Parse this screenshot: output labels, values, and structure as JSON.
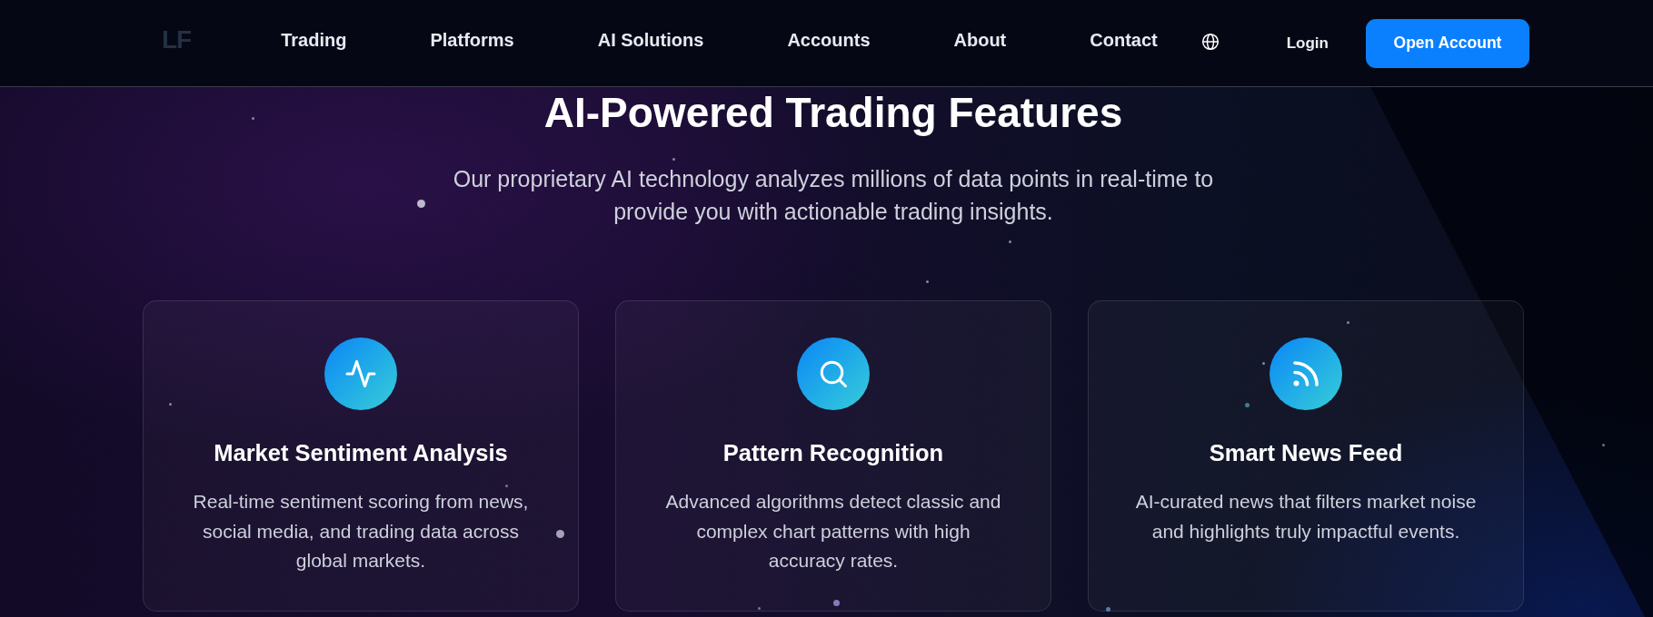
{
  "header": {
    "logo": "LF",
    "nav": [
      "Trading",
      "Platforms",
      "AI Solutions",
      "Accounts",
      "About",
      "Contact"
    ],
    "login": "Login",
    "cta": "Open Account"
  },
  "hero": {
    "title": "AI-Powered Trading Features",
    "subtitle": "Our proprietary AI technology analyzes millions of data points in real-time to provide you with actionable trading insights."
  },
  "features": [
    {
      "title": "Market Sentiment Analysis",
      "description": "Real-time sentiment scoring from news, social media, and trading data across global markets."
    },
    {
      "title": "Pattern Recognition",
      "description": "Advanced algorithms detect classic and complex chart patterns with high accuracy rates."
    },
    {
      "title": "Smart News Feed",
      "description": "AI-curated news that filters market noise and highlights truly impactful events."
    }
  ]
}
